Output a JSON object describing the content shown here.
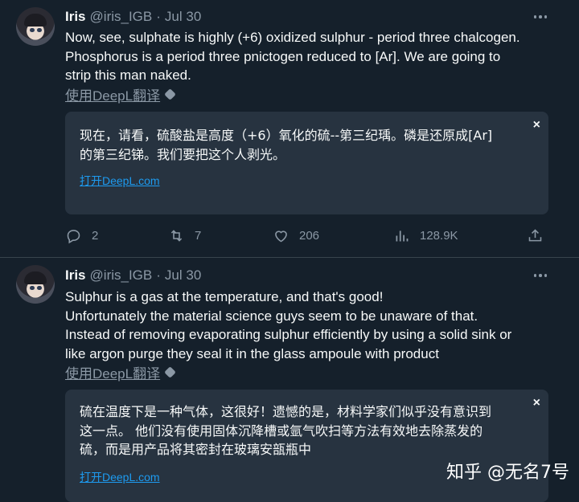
{
  "tweets": [
    {
      "name": "Iris",
      "handle": "@iris_IGB",
      "separator": "·",
      "date": "Jul 30",
      "lines": [
        "Now, see, sulphate is highly (+6) oxidized sulphur - period three chalcogen.",
        "Phosphorus is a period three pnictogen reduced to [Ar]. We are going to",
        "strip this man naked."
      ],
      "translate_link": "使用DeepL翻译",
      "translation": {
        "lines": [
          "现在，请看，硫酸盐是高度（+6）氧化的硫--第三纪瑀。磷是还原成[Ar]",
          "的第三纪锑。我们要把这个人剥光。"
        ],
        "open_link": "打开DeepL.com",
        "close": "×"
      },
      "stats": {
        "replies": "2",
        "retweets": "7",
        "likes": "206",
        "views": "128.9K"
      }
    },
    {
      "name": "Iris",
      "handle": "@iris_IGB",
      "separator": "·",
      "date": "Jul 30",
      "lines": [
        "Sulphur is a gas at the temperature, and that's good!",
        "Unfortunately the material science guys seem to be unaware of that.",
        "Instead of removing evaporating sulphur efficiently by using a solid sink or",
        "like argon purge they seal it in the glass ampoule with product"
      ],
      "translate_link": "使用DeepL翻译",
      "translation": {
        "lines": [
          "硫在温度下是一种气体，这很好！遗憾的是，材料学家们似乎没有意识到",
          "这一点。 他们没有使用固体沉降槽或氩气吹扫等方法有效地去除蒸发的",
          "硫，而是用产品将其密封在玻璃安瓿瓶中"
        ],
        "open_link": "打开DeepL.com",
        "close": "×"
      }
    }
  ],
  "watermark": "知乎 @无名7号",
  "icons": [
    "reply-icon",
    "retweet-icon",
    "like-icon",
    "views-icon",
    "share-icon",
    "more-icon",
    "deepl-icon",
    "close-icon"
  ],
  "colors": {
    "background": "#15202b",
    "card": "#273340",
    "link": "#1d9bf0",
    "muted": "#8b98a5",
    "text": "#f7f9f9"
  }
}
